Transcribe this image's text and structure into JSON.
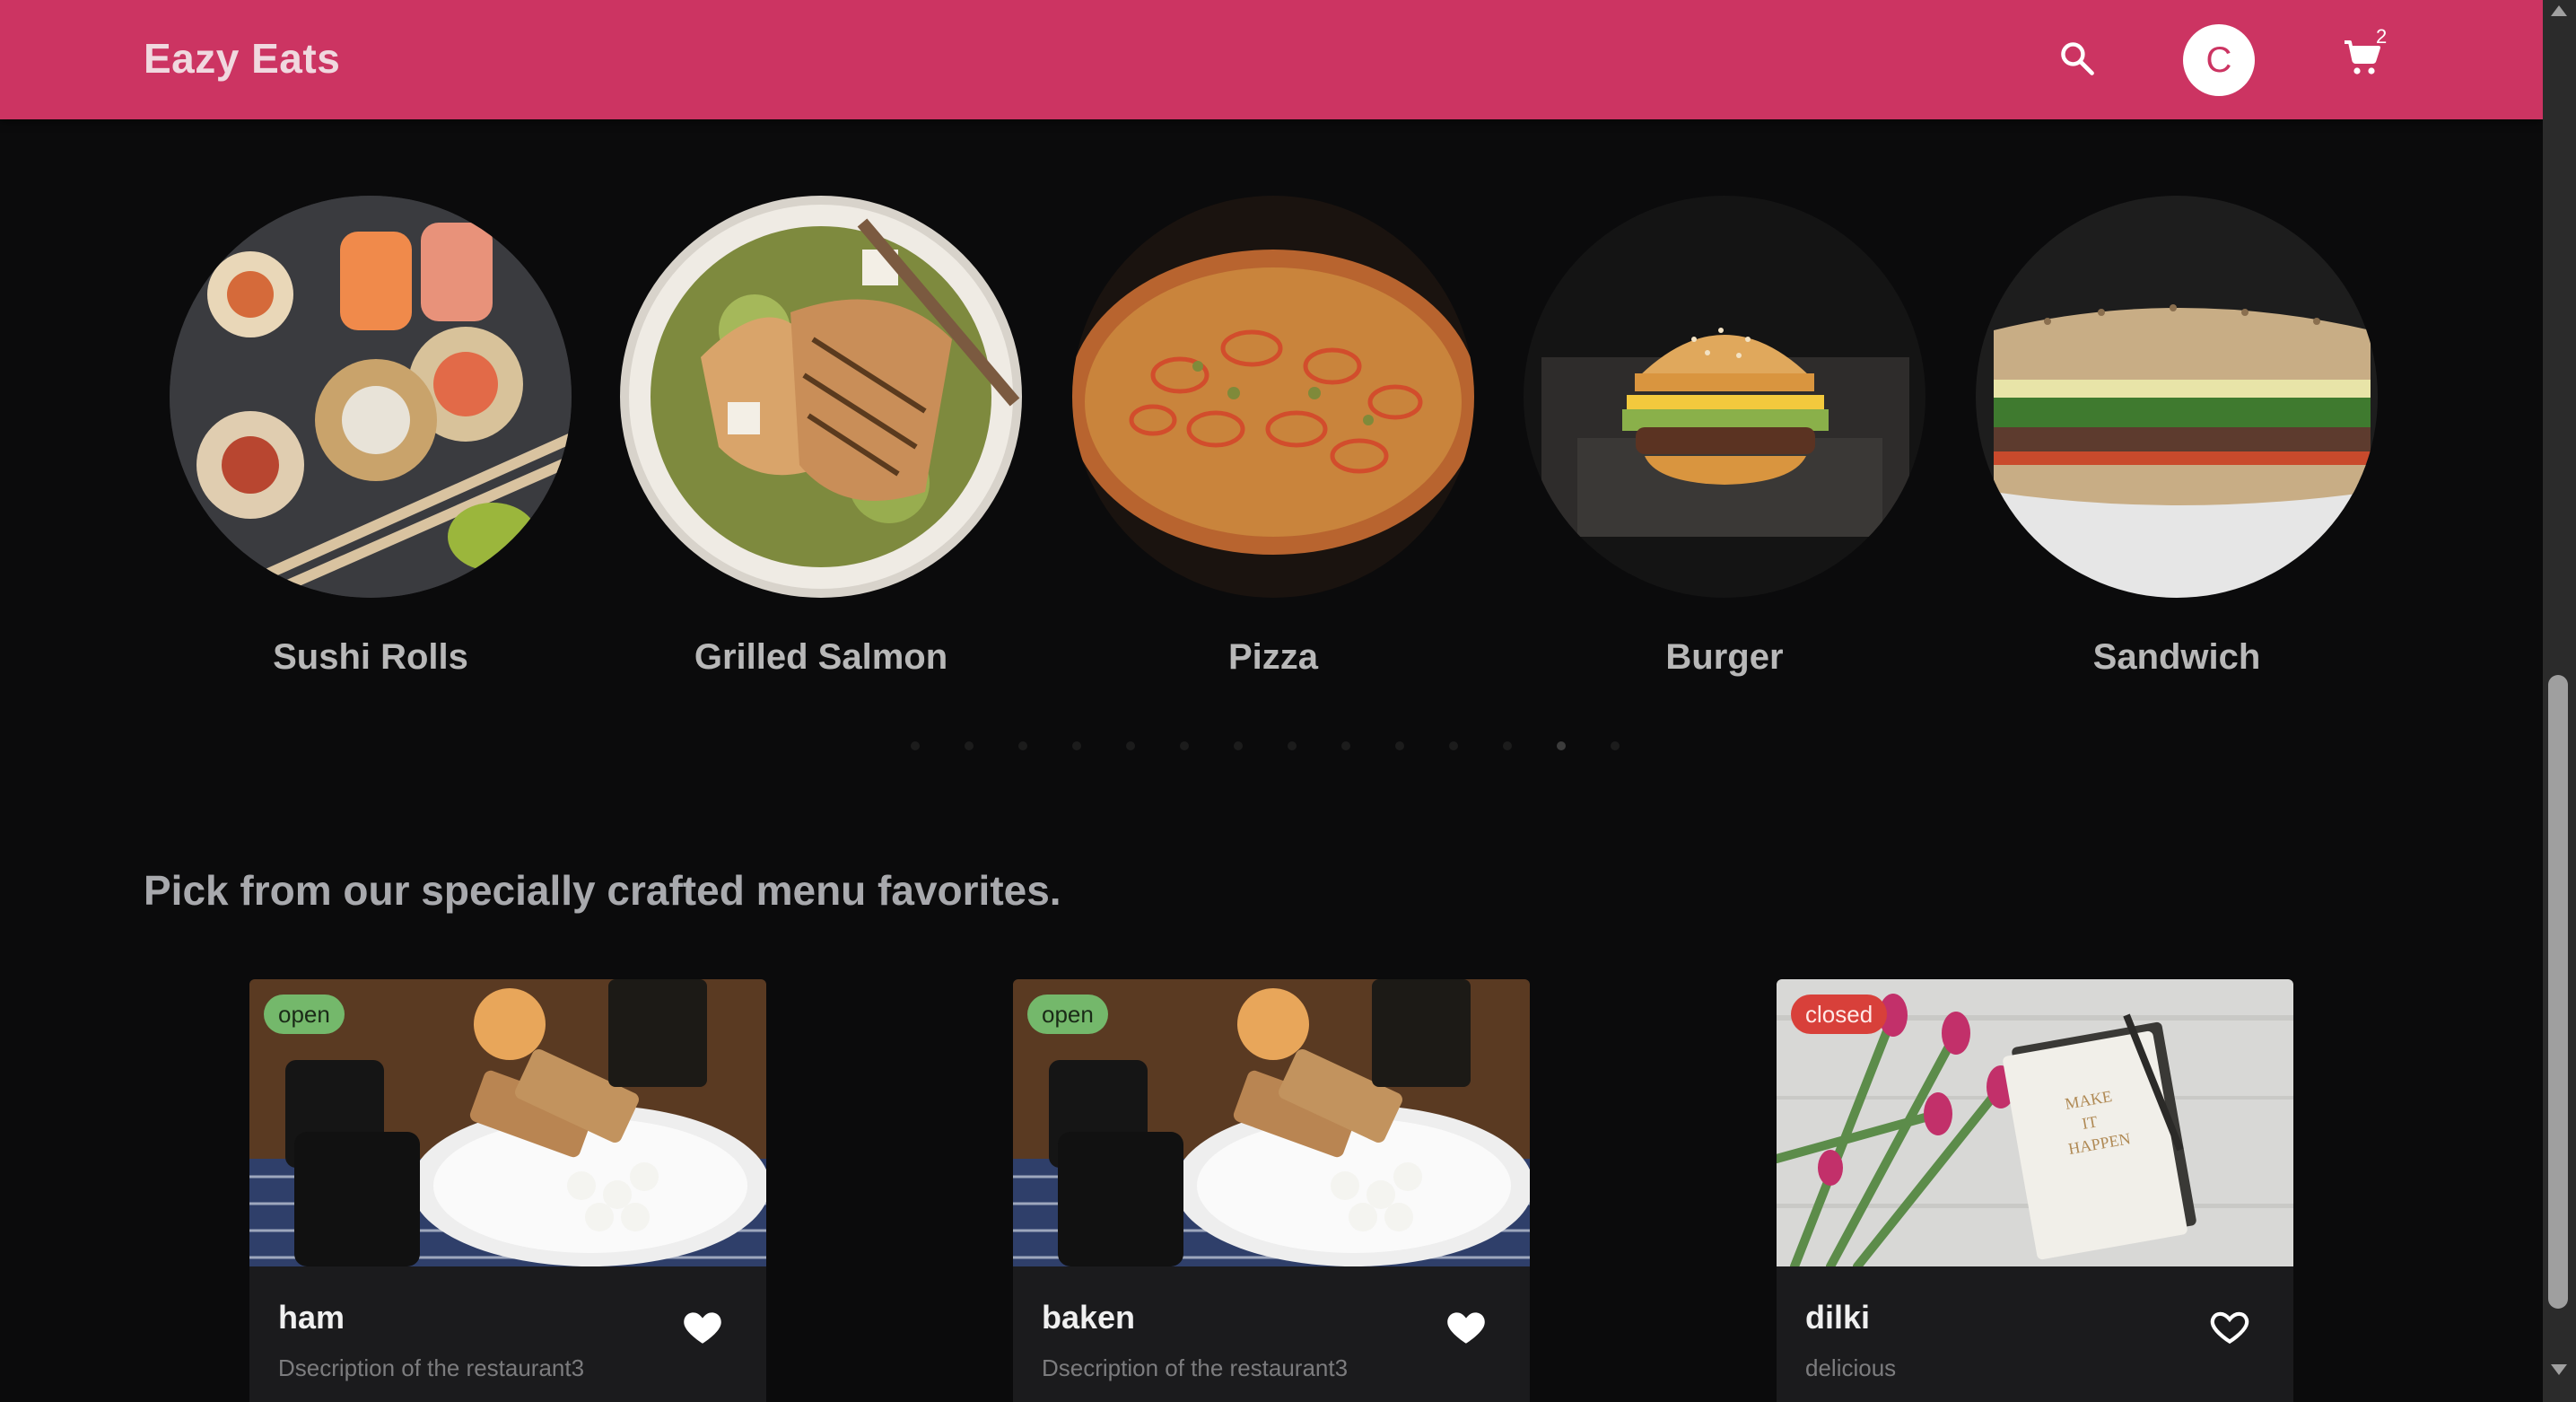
{
  "app": {
    "title": "Eazy Eats"
  },
  "header": {
    "search_icon": "search-icon",
    "avatar_letter": "C",
    "cart_icon": "cart-icon",
    "cart_count": "2",
    "bar_color": "#cc3462"
  },
  "categories": [
    {
      "label": "Sushi Rolls"
    },
    {
      "label": "Grilled Salmon"
    },
    {
      "label": "Pizza"
    },
    {
      "label": "Burger"
    },
    {
      "label": "Sandwich"
    }
  ],
  "carousel": {
    "dot_count": 14,
    "active_index": 12
  },
  "section": {
    "heading": "Pick from our specially crafted menu favorites."
  },
  "cards": [
    {
      "status": "open",
      "title": "ham",
      "description": "Dsecription of the restaurant3",
      "favorited": true
    },
    {
      "status": "open",
      "title": "baken",
      "description": "Dsecription of the restaurant3",
      "favorited": true
    },
    {
      "status": "closed",
      "title": "dilki",
      "description": "delicious",
      "favorited": false
    }
  ],
  "colors": {
    "open": "#74b86b",
    "closed": "#d8403a",
    "background": "#0b0b0c"
  }
}
